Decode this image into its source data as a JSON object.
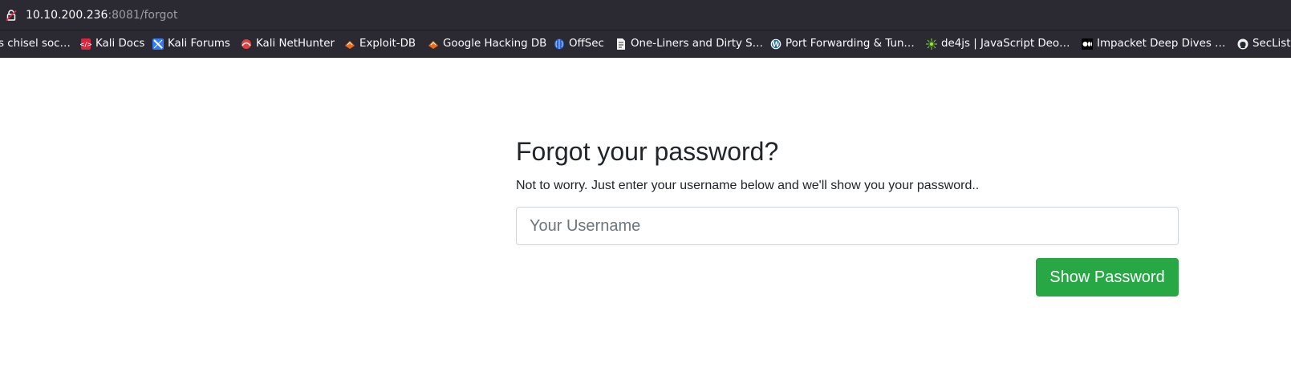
{
  "browser": {
    "url_host": "10.10.200.236",
    "url_path": ":8081/forgot"
  },
  "bookmarks": [
    {
      "label": "s chisel soc…",
      "icon": "none"
    },
    {
      "label": "Kali Docs",
      "icon": "kali-docs-icon"
    },
    {
      "label": "Kali Forums",
      "icon": "kali-forums-icon"
    },
    {
      "label": "Kali NetHunter",
      "icon": "kali-nethunter-icon"
    },
    {
      "label": "Exploit-DB",
      "icon": "exploit-db-icon"
    },
    {
      "label": "Google Hacking DB",
      "icon": "ghdb-icon"
    },
    {
      "label": "OffSec",
      "icon": "offsec-icon"
    },
    {
      "label": "One-Liners and Dirty S…",
      "icon": "document-icon"
    },
    {
      "label": "Port Forwarding & Tun…",
      "icon": "wordpress-icon"
    },
    {
      "label": "de4js | JavaScript Deo…",
      "icon": "de4js-icon"
    },
    {
      "label": "Impacket Deep Dives …",
      "icon": "medium-icon"
    },
    {
      "label": "SecList",
      "icon": "github-icon"
    }
  ],
  "form": {
    "title": "Forgot your password?",
    "subtitle": "Not to worry. Just enter your username below and we'll show you your password..",
    "username_placeholder": "Your Username",
    "username_value": "",
    "submit_label": "Show Password"
  },
  "colors": {
    "toolbar_bg": "#2b2a33",
    "button_green": "#28a745",
    "heading_text": "#212529",
    "input_border": "#ced4da"
  }
}
